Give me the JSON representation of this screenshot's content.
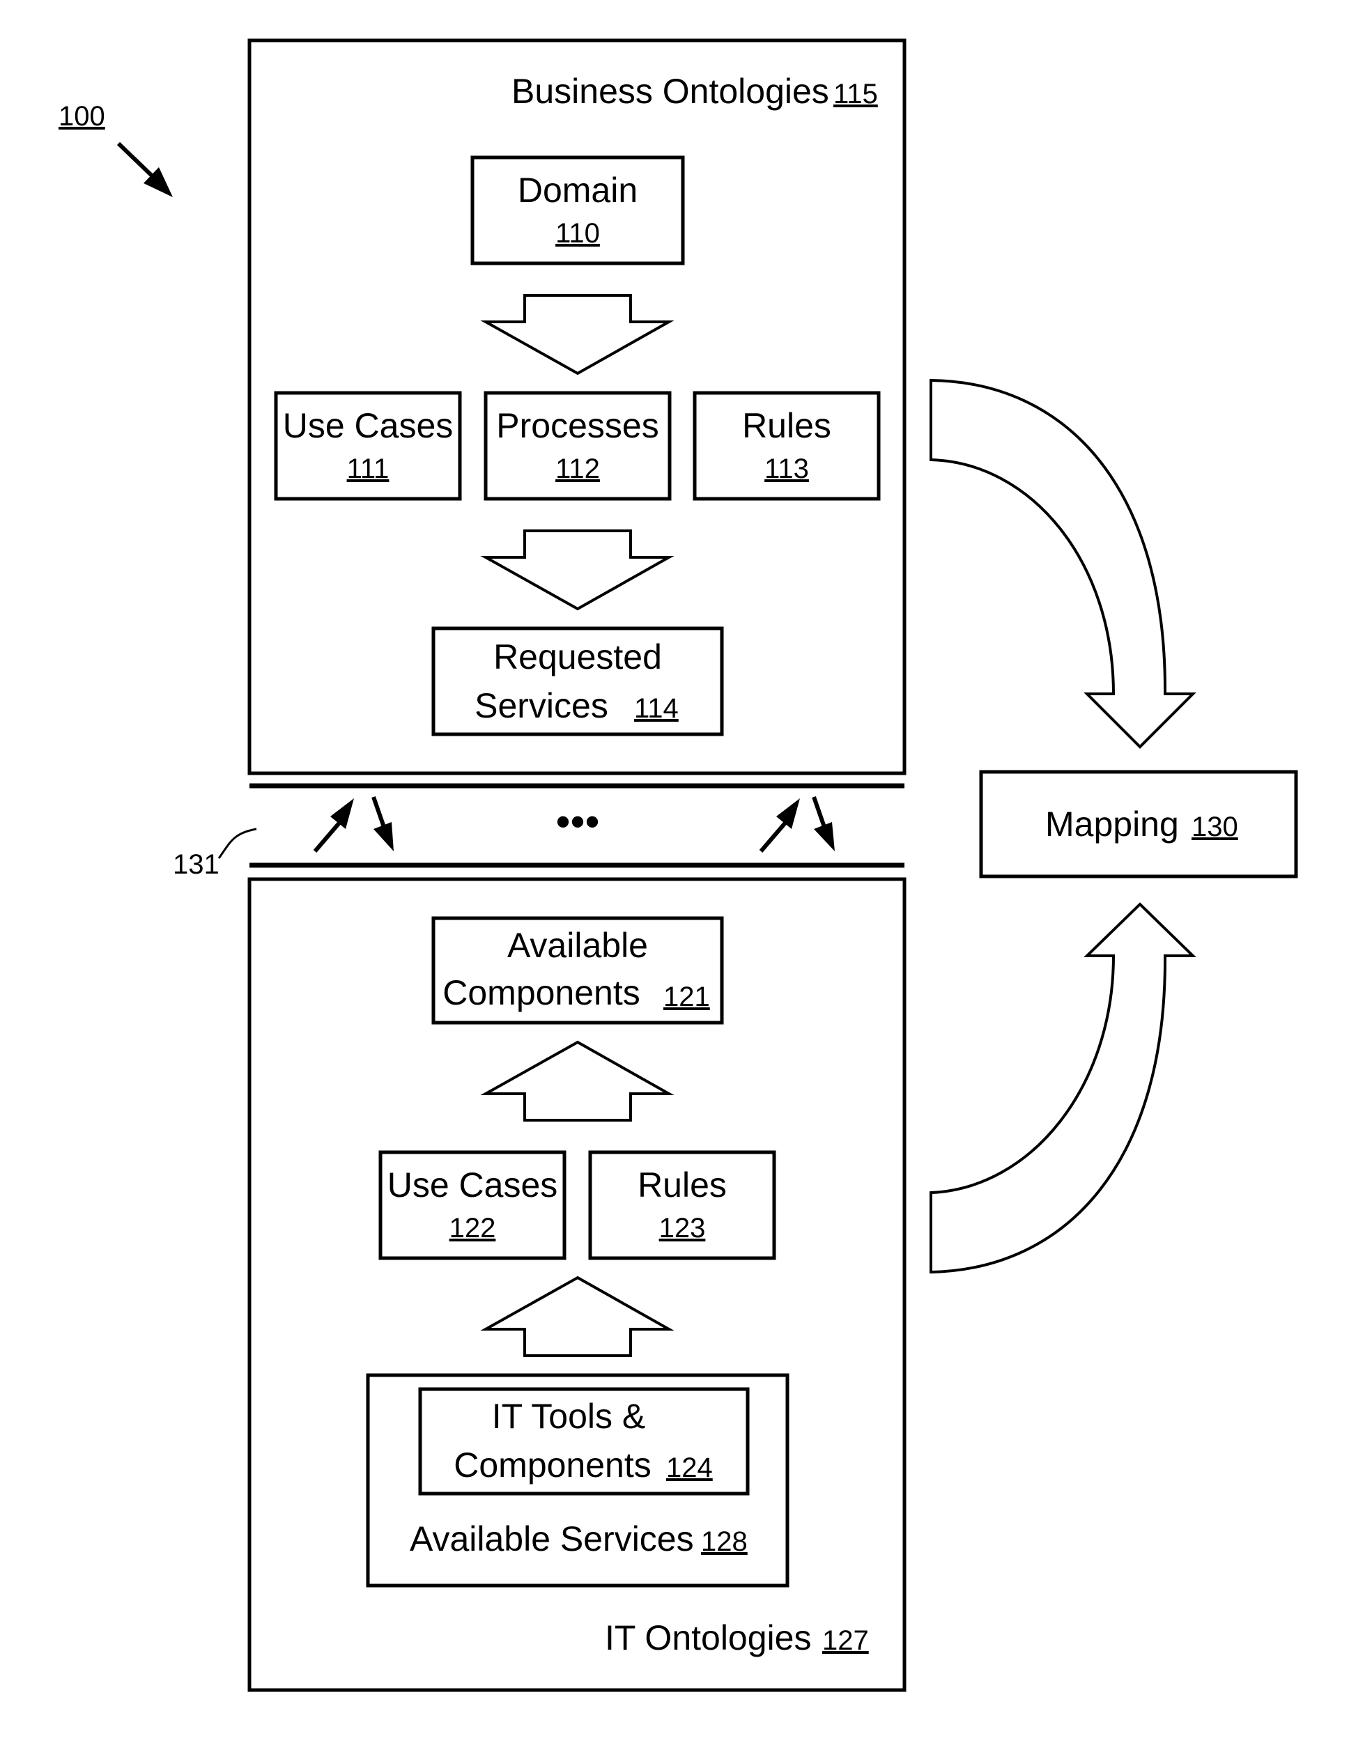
{
  "figure_ref": "100",
  "business": {
    "title": "Business Ontologies",
    "num": "115",
    "domain": {
      "label": "Domain",
      "num": "110"
    },
    "use_cases": {
      "label": "Use Cases",
      "num": "111"
    },
    "processes": {
      "label": "Processes",
      "num": "112"
    },
    "rules": {
      "label": "Rules",
      "num": "113"
    },
    "requested": {
      "line1": "Requested",
      "line2": "Services",
      "num": "114"
    }
  },
  "interface": {
    "ref": "131",
    "ellipsis": "•••"
  },
  "mapping": {
    "label": "Mapping",
    "num": "130"
  },
  "it": {
    "title": "IT Ontologies",
    "num": "127",
    "available_components": {
      "line1": "Available",
      "line2": "Components",
      "num": "121"
    },
    "use_cases": {
      "label": "Use Cases",
      "num": "122"
    },
    "rules": {
      "label": "Rules",
      "num": "123"
    },
    "tools": {
      "line1": "IT Tools &",
      "line2": "Components",
      "num": "124"
    },
    "available_services": {
      "label": "Available Services",
      "num": "128"
    }
  }
}
